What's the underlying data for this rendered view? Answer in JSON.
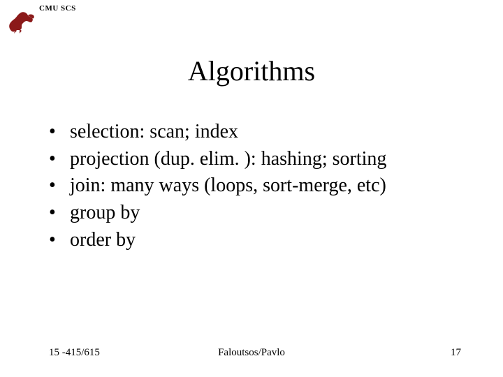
{
  "header": {
    "org": "CMU SCS"
  },
  "title": "Algorithms",
  "bullets": [
    "selection: scan; index",
    "projection (dup. elim. ): hashing; sorting",
    "join: many ways (loops, sort-merge, etc)",
    "group by",
    "order by"
  ],
  "footer": {
    "left": "15 -415/615",
    "center": "Faloutsos/Pavlo",
    "right": "17"
  },
  "colors": {
    "accent": "#8b1a1a"
  }
}
